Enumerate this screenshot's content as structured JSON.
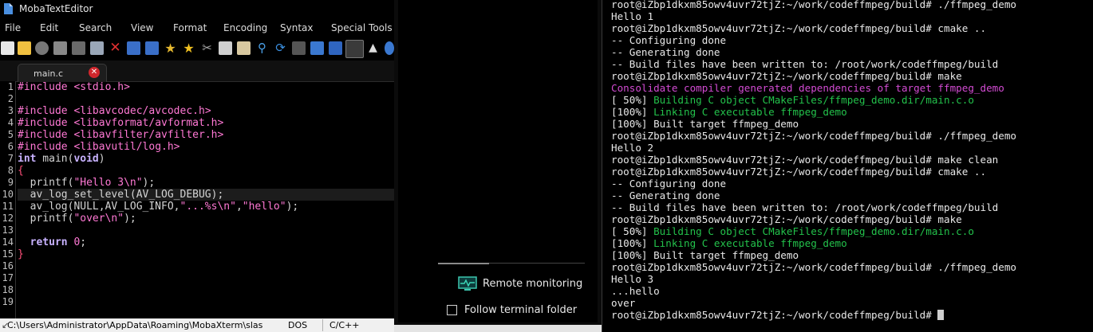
{
  "app": {
    "title": "MobaTextEditor"
  },
  "menu": [
    "File",
    "Edit",
    "Search",
    "View",
    "Format",
    "Encoding",
    "Syntax",
    "Special Tools"
  ],
  "tab": {
    "label": "main.c",
    "close": "✕"
  },
  "gutter": [
    "1",
    "2",
    "3",
    "4",
    "5",
    "6",
    "7",
    "8",
    "9",
    "10",
    "11",
    "12",
    "13",
    "14",
    "15",
    "16",
    "17",
    "18",
    "19"
  ],
  "code": {
    "l1": {
      "a": "#include ",
      "b": "<stdio.h>"
    },
    "l3": {
      "a": "#include ",
      "b": "<libavcodec/avcodec.h>"
    },
    "l4": {
      "a": "#include ",
      "b": "<libavformat/avformat.h>"
    },
    "l5": {
      "a": "#include ",
      "b": "<libavfilter/avfilter.h>"
    },
    "l6": {
      "a": "#include ",
      "b": "<libavutil/log.h>"
    },
    "l7": {
      "kw1": "int",
      "mid": " main(",
      "kw2": "void",
      "end": ")"
    },
    "l8": {
      "a": "{"
    },
    "l9": {
      "a": "  printf(",
      "s": "\"Hello 3\\n\"",
      "b": ");"
    },
    "l10": {
      "a": "  av_log_set_level(AV_LOG_DEBUG);"
    },
    "l11": {
      "a": "  av_log(NULL,AV_LOG_INFO,",
      "s1": "\"...%s\\n\"",
      "c": ",",
      "s2": "\"hello\"",
      "b": ");"
    },
    "l12": {
      "a": "  printf(",
      "s": "\"over\\n\"",
      "b": ");"
    },
    "l14": {
      "kw": "  return ",
      "n": "0",
      "b": ";"
    },
    "l15": {
      "a": "}"
    }
  },
  "status": {
    "path": "C:\\Users\\Administrator\\AppData\\Roaming\\MobaXterm\\slas",
    "eol": "DOS",
    "lang": "C/C++"
  },
  "sidepanel": {
    "remote_monitoring": "Remote monitoring",
    "follow_folder": "Follow terminal folder"
  },
  "terminal": {
    "lines": [
      {
        "t": "root@iZbp1dkxm85owv4uvr72tjZ:~/work/codeffmpeg/build# ./ffmpeg_demo",
        "c": ""
      },
      {
        "t": "Hello 1",
        "c": ""
      },
      {
        "t": "root@iZbp1dkxm85owv4uvr72tjZ:~/work/codeffmpeg/build# cmake ..",
        "c": ""
      },
      {
        "t": "-- Configuring done",
        "c": ""
      },
      {
        "t": "-- Generating done",
        "c": ""
      },
      {
        "t": "-- Build files have been written to: /root/work/codeffmpeg/build",
        "c": ""
      },
      {
        "t": "root@iZbp1dkxm85owv4uvr72tjZ:~/work/codeffmpeg/build# make",
        "c": ""
      },
      {
        "t": "Consolidate compiler generated dependencies of target ffmpeg_demo",
        "c": "m"
      },
      {
        "p": "[ 50%] ",
        "t": "Building C object CMakeFiles/ffmpeg_demo.dir/main.c.o",
        "c": "pg"
      },
      {
        "p": "[100%] ",
        "t": "Linking C executable ffmpeg_demo",
        "c": "pg"
      },
      {
        "t": "[100%] Built target ffmpeg_demo",
        "c": ""
      },
      {
        "t": "root@iZbp1dkxm85owv4uvr72tjZ:~/work/codeffmpeg/build# ./ffmpeg_demo",
        "c": ""
      },
      {
        "t": "Hello 2",
        "c": ""
      },
      {
        "t": "root@iZbp1dkxm85owv4uvr72tjZ:~/work/codeffmpeg/build# make clean",
        "c": ""
      },
      {
        "t": "root@iZbp1dkxm85owv4uvr72tjZ:~/work/codeffmpeg/build# cmake ..",
        "c": ""
      },
      {
        "t": "-- Configuring done",
        "c": ""
      },
      {
        "t": "-- Generating done",
        "c": ""
      },
      {
        "t": "-- Build files have been written to: /root/work/codeffmpeg/build",
        "c": ""
      },
      {
        "t": "root@iZbp1dkxm85owv4uvr72tjZ:~/work/codeffmpeg/build# make",
        "c": ""
      },
      {
        "p": "[ 50%] ",
        "t": "Building C object CMakeFiles/ffmpeg_demo.dir/main.c.o",
        "c": "pg"
      },
      {
        "p": "[100%] ",
        "t": "Linking C executable ffmpeg_demo",
        "c": "pg"
      },
      {
        "t": "[100%] Built target ffmpeg_demo",
        "c": ""
      },
      {
        "t": "root@iZbp1dkxm85owv4uvr72tjZ:~/work/codeffmpeg/build# ./ffmpeg_demo",
        "c": ""
      },
      {
        "t": "Hello 3",
        "c": ""
      },
      {
        "t": "...hello",
        "c": ""
      },
      {
        "t": "over",
        "c": ""
      },
      {
        "t": "root@iZbp1dkxm85owv4uvr72tjZ:~/work/codeffmpeg/build# ",
        "c": "cursor"
      }
    ]
  },
  "colors": {
    "prompt_green": "#23c24b",
    "magenta": "#d34bd3",
    "keyword": "#c8b2ff",
    "string": "#ff78d4",
    "close_red": "#d0262c"
  }
}
